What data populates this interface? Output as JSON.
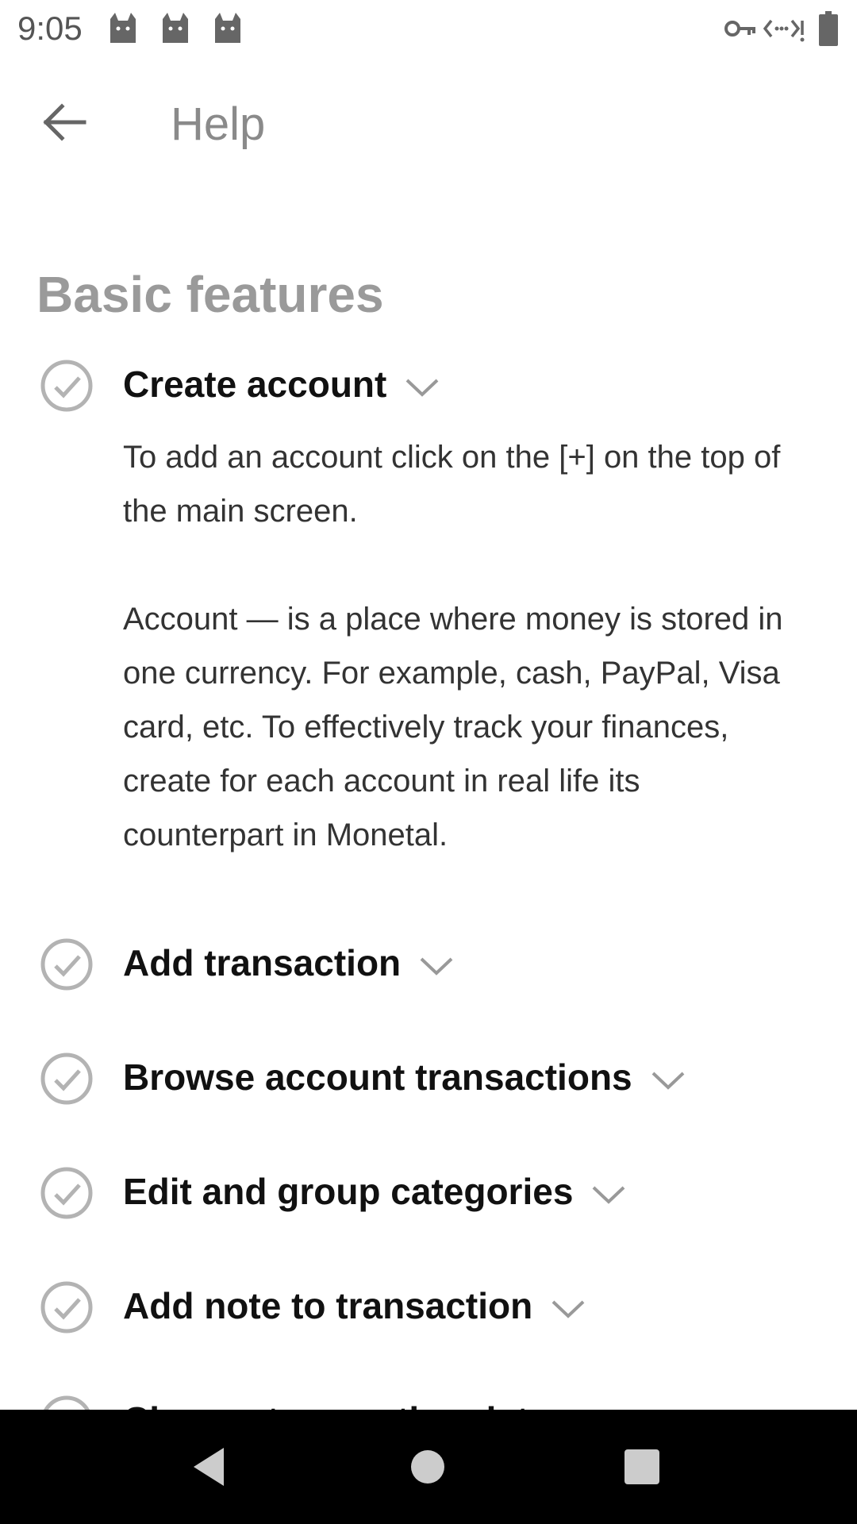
{
  "status_bar": {
    "time": "9:05",
    "icons": [
      "cat-icon",
      "cat-icon",
      "cat-icon",
      "key-icon",
      "data-icon",
      "battery-icon"
    ]
  },
  "app_bar": {
    "title": "Help",
    "back_icon": "arrow-left-icon"
  },
  "section": {
    "title": "Basic features"
  },
  "faq": [
    {
      "title": "Create account",
      "expanded": true,
      "body_paragraphs": [
        "To add an account click on the [+] on the top of the main screen.",
        "Account — is a place where money is stored in one currency. For example, cash, PayPal, Visa card, etc. To effectively track your finances, create for each account in real life its counterpart in Monetal."
      ]
    },
    {
      "title": "Add transaction",
      "expanded": false
    },
    {
      "title": "Browse account transactions",
      "expanded": false
    },
    {
      "title": "Edit and group categories",
      "expanded": false
    },
    {
      "title": "Add note to transaction",
      "expanded": false
    },
    {
      "title": "Change transaction date",
      "expanded": false
    }
  ],
  "colors": {
    "icon_gray": "#b3b3b3",
    "title_text": "#111111",
    "body_text": "#333333",
    "section_text": "#9a9a9a",
    "nav_bg": "#000000"
  },
  "nav_bar": {
    "buttons": [
      "back-triangle-icon",
      "home-circle-icon",
      "recents-square-icon"
    ]
  }
}
